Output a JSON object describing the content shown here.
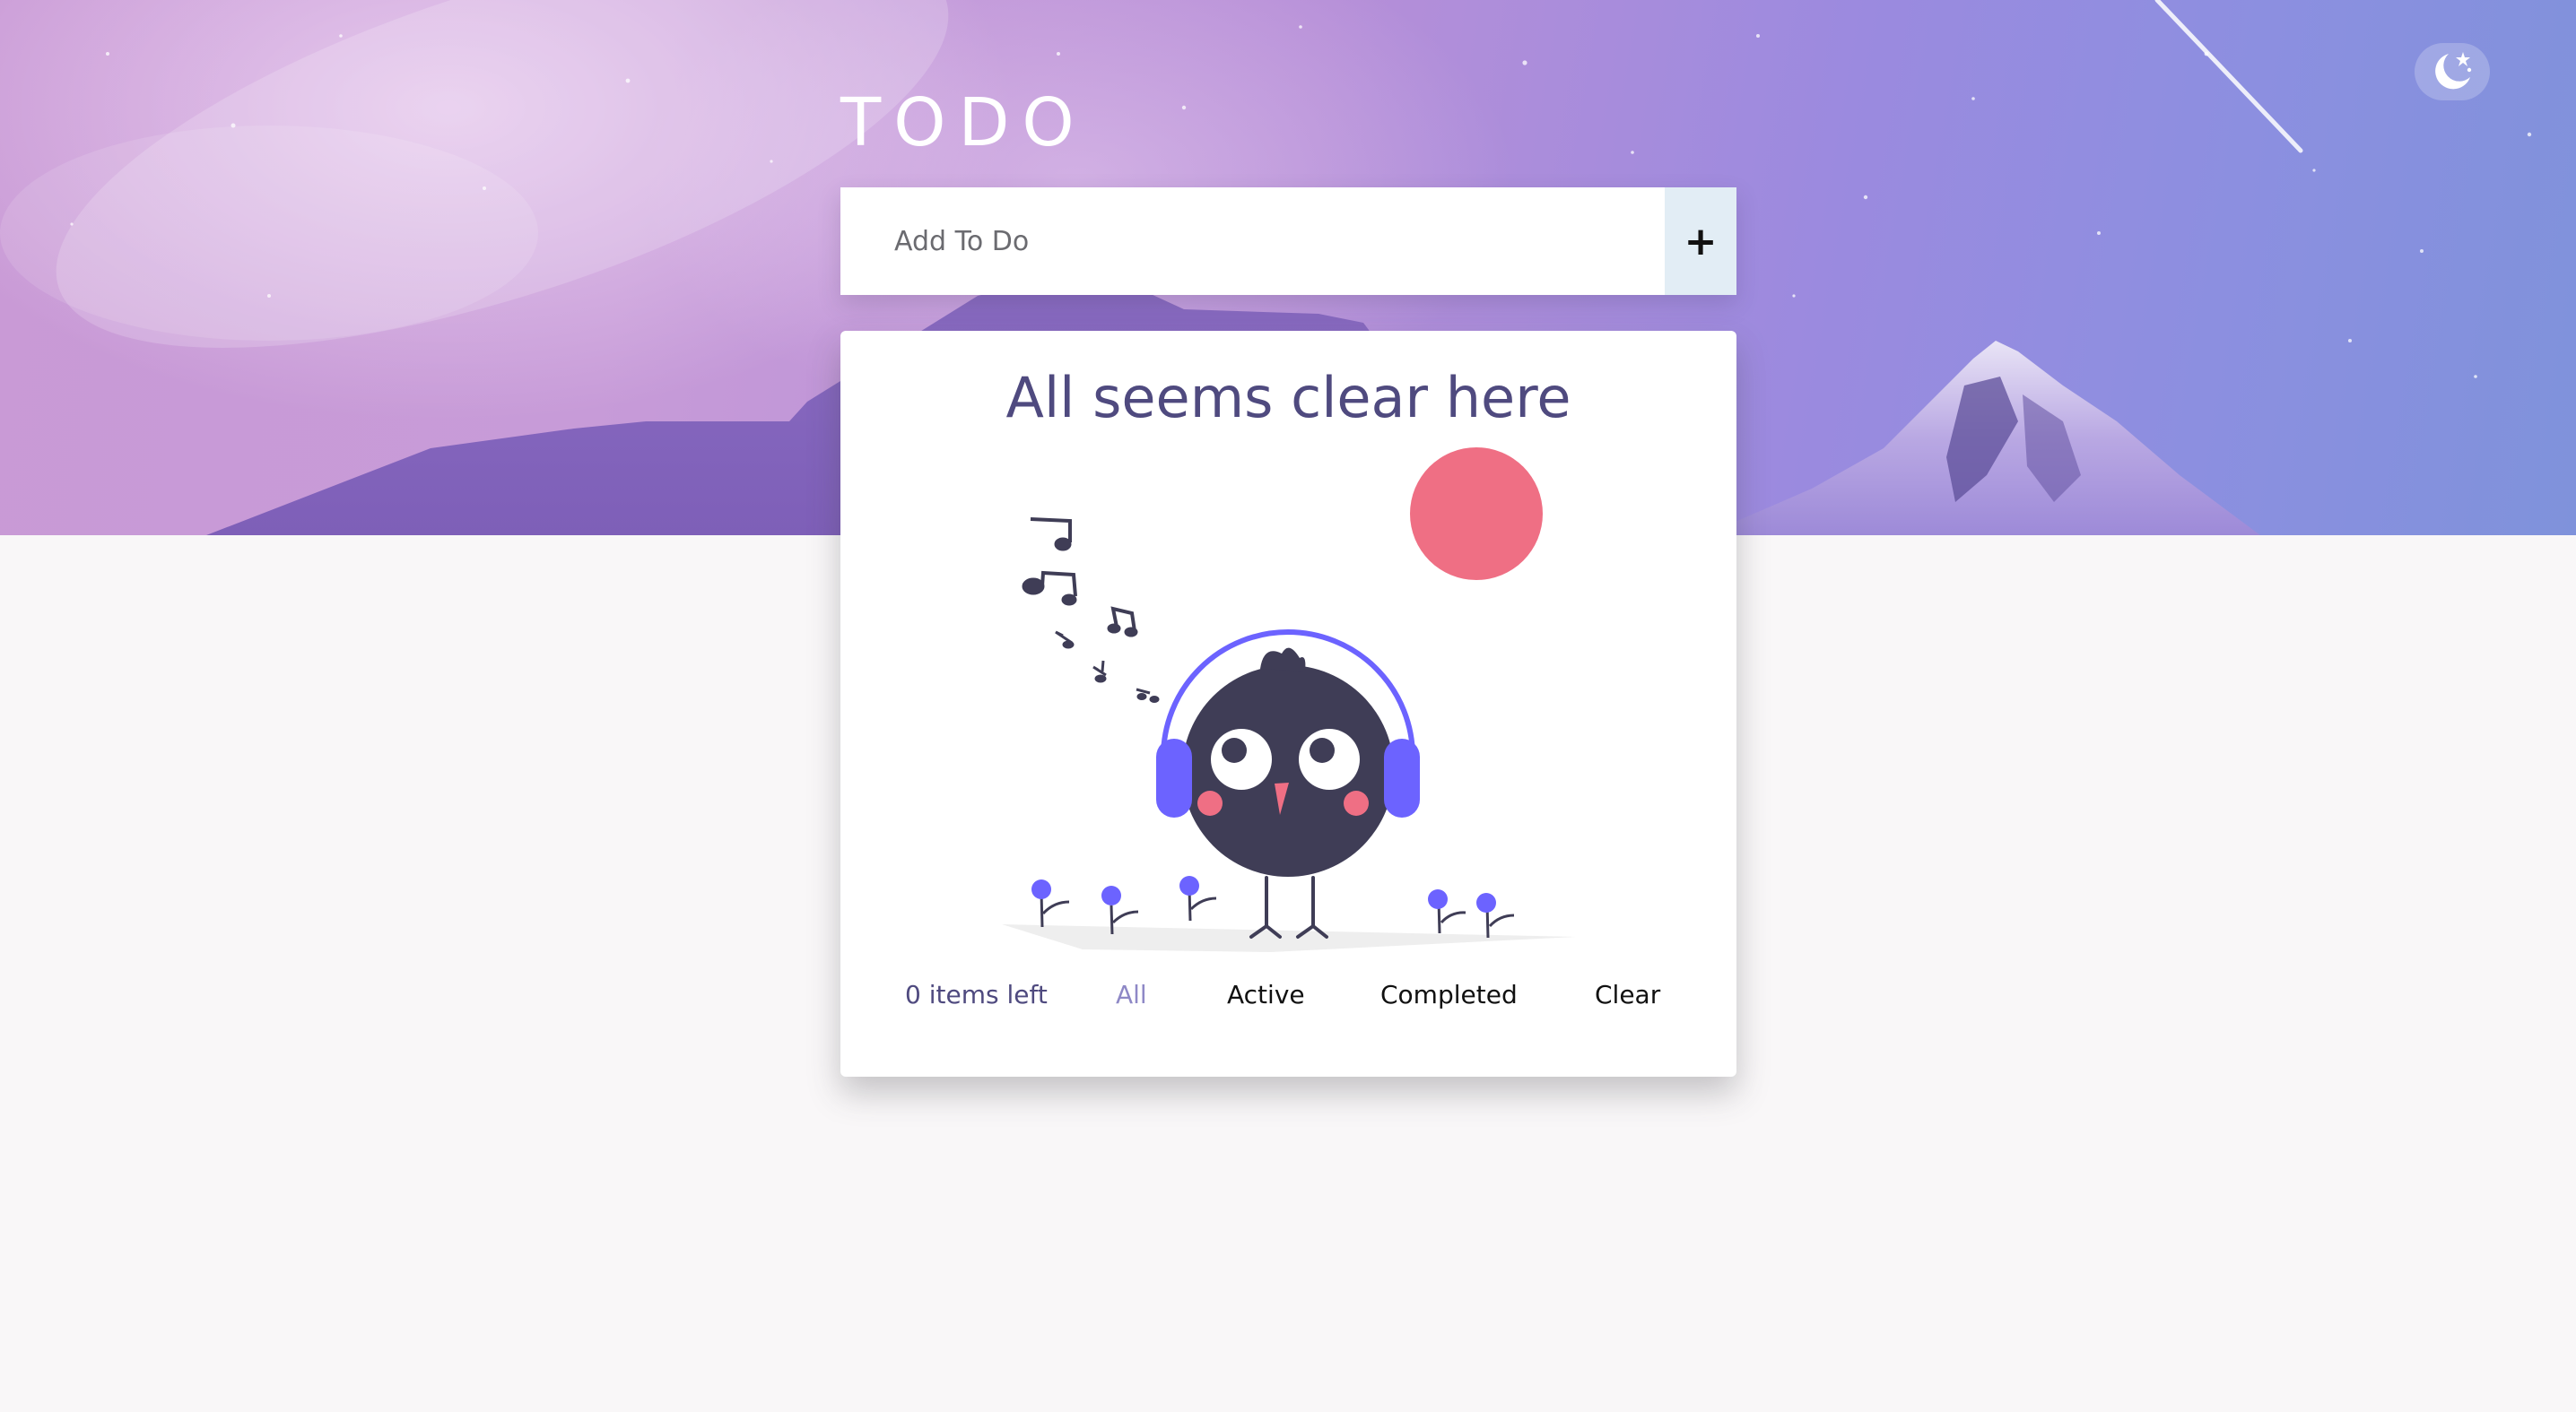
{
  "app": {
    "title": "TODO"
  },
  "header": {
    "theme_toggle_icon": "moon-stars-icon"
  },
  "add_form": {
    "placeholder": "Add To Do",
    "value": "",
    "add_button_label": "+",
    "add_button_icon": "plus-icon"
  },
  "todo_list": {
    "items": [],
    "empty_state": {
      "heading": "All seems clear here",
      "illustration": "bird-with-headphones-illustration"
    }
  },
  "footer": {
    "items_left": "0 items left",
    "filters": {
      "all": "All",
      "active": "Active",
      "completed": "Completed"
    },
    "selected_filter": "All",
    "clear_label": "Clear"
  },
  "colors": {
    "accent": "#6c63ff",
    "heading": "#4f4a7f",
    "selected_filter": "#8e88c6",
    "sun": "#ef6f84",
    "bird": "#3f3d56",
    "page_background": "#f9f7f8"
  }
}
